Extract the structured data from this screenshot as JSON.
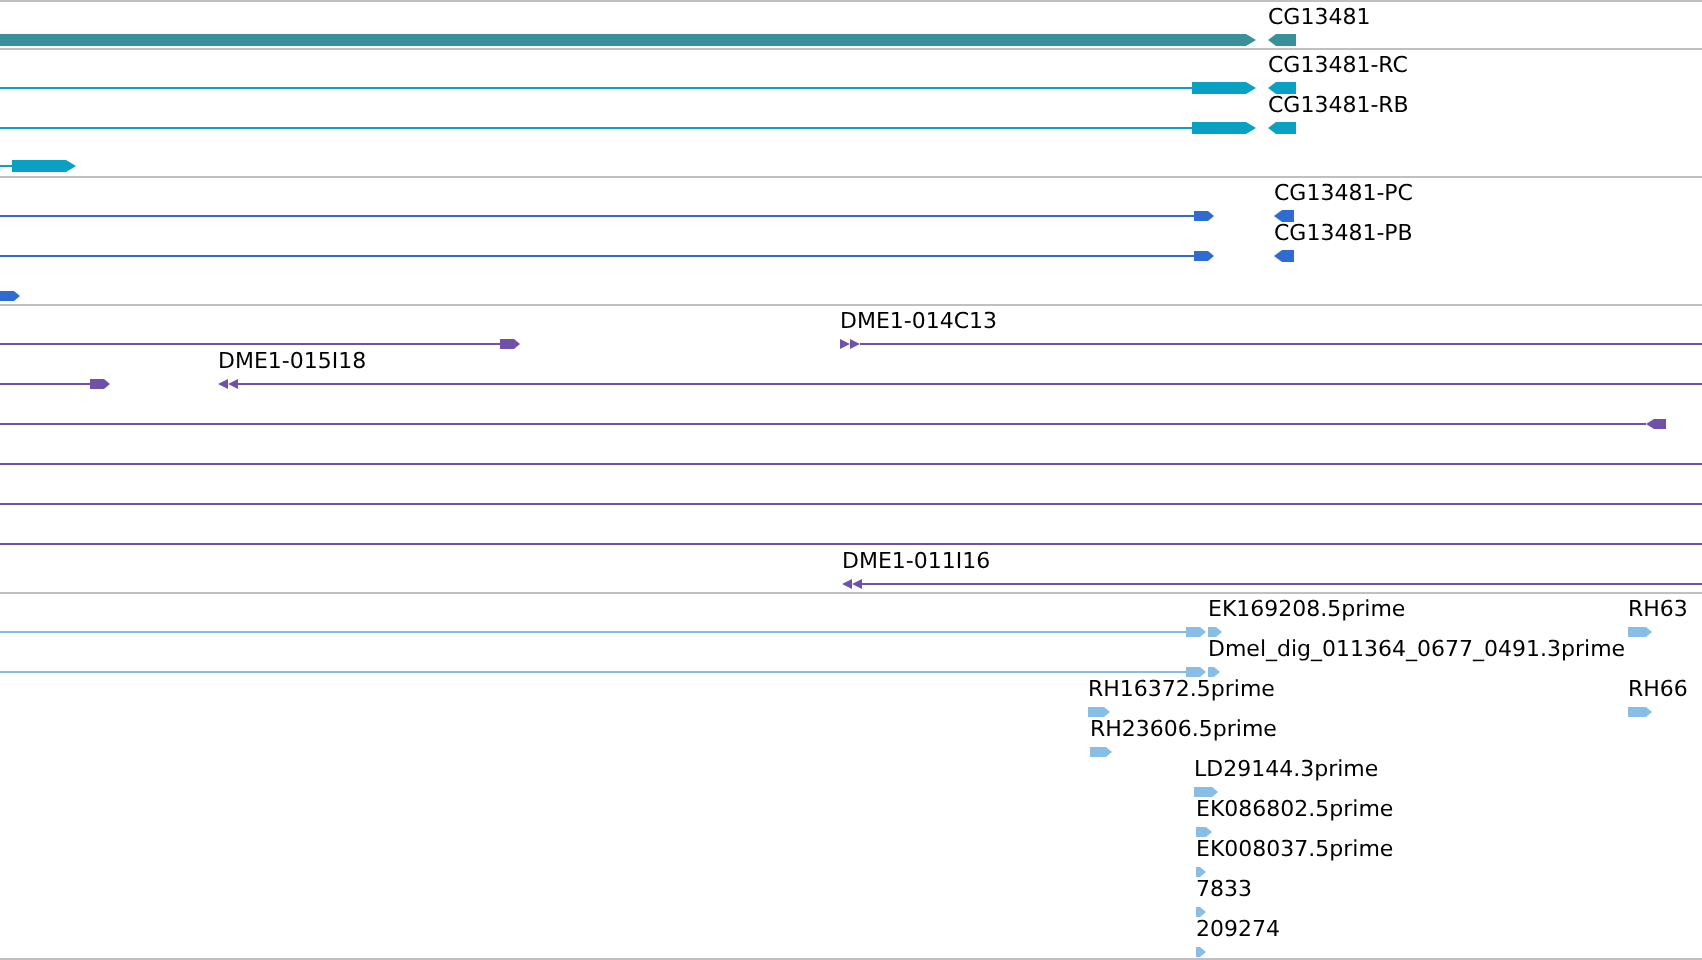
{
  "tracks": [
    {
      "color": "#3a9098",
      "features": [
        {
          "kind": "bar_right"
        },
        {
          "kind": "stub_left",
          "label": "CG13481"
        }
      ]
    },
    {
      "color": "#0aa0c4",
      "features": [
        {
          "kind": "intron_exon_right"
        },
        {
          "kind": "stub_left",
          "label": "CG13481-RC"
        },
        {
          "kind": "intron_exon_right"
        },
        {
          "kind": "stub_left",
          "label": "CG13481-RB"
        },
        {
          "kind": "intron_exon_right"
        }
      ]
    },
    {
      "color": "#2f6bd0",
      "features": [
        {
          "kind": "line_arrow_right"
        },
        {
          "kind": "stub_left",
          "label": "CG13481-PC"
        },
        {
          "kind": "line_arrow_right"
        },
        {
          "kind": "stub_left",
          "label": "CG13481-PB"
        },
        {
          "kind": "line_arrow_right"
        }
      ]
    },
    {
      "color": "#6f52a8",
      "features": [
        {
          "kind": "line_arrow_right"
        },
        {
          "kind": "double_right_line",
          "label": "DME1-014C13"
        },
        {
          "kind": "line_arrow_right"
        },
        {
          "kind": "double_left_line",
          "label": "DME1-015I18"
        },
        {
          "kind": "line_stub_left"
        },
        {
          "kind": "line"
        },
        {
          "kind": "line"
        },
        {
          "kind": "line"
        },
        {
          "kind": "double_left_line",
          "label": "DME1-011I16"
        }
      ]
    },
    {
      "color": "#88bde6",
      "features": [
        {
          "kind": "line_arrow_right"
        },
        {
          "kind": "est_arrow",
          "label": "EK169208.5prime"
        },
        {
          "kind": "line_arrow_right"
        },
        {
          "kind": "est_arrow",
          "label": "Dmel_dig_011364_0677_0491.3prime"
        },
        {
          "kind": "est_arrow",
          "label": "RH16372.5prime"
        },
        {
          "kind": "est_arrow",
          "label": "RH23606.5prime"
        },
        {
          "kind": "est_arrow",
          "label": "LD29144.3prime"
        },
        {
          "kind": "est_arrow",
          "label": "EK086802.5prime"
        },
        {
          "kind": "est_arrow",
          "label": "EK008037.5prime"
        },
        {
          "kind": "est_arrow",
          "label": "7833"
        },
        {
          "kind": "est_arrow",
          "label": "209274"
        },
        {
          "kind": "est_arrow",
          "label": "RH63"
        },
        {
          "kind": "est_arrow",
          "label": "RH66"
        }
      ]
    }
  ]
}
